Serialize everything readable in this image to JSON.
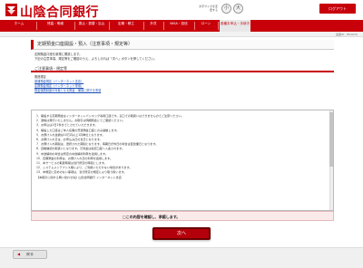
{
  "header": {
    "bank_name": "山陰合同銀行",
    "fontsize_label": "文字サイズを変更する",
    "fontsize_small": "小",
    "fontsize_large": "大",
    "logout": "ログアウト"
  },
  "nav": {
    "items": [
      {
        "label": "ホーム"
      },
      {
        "label": "残高・明細"
      },
      {
        "label": "振込・振替・払込"
      },
      {
        "label": "定期・積立"
      },
      {
        "label": "外貨"
      },
      {
        "label": "NISA・投信"
      },
      {
        "label": "ローン"
      },
      {
        "label": "各種お申込・手続き"
      }
    ]
  },
  "screen_id": "画面ID：BSA010",
  "page": {
    "title": "定期預金口座開設・預入（注意事項・規定等）",
    "intro": [
      "定期預金口座を新規に開設します。",
      "下記の注意事項、規定等をご確認のうえ、よろしければ「次へ」ボタンを押してください。"
    ],
    "section_title": "ご注意事項・規定等",
    "links_head": "関連規定",
    "links": [
      "普通預金規定（インターネット支店）",
      "定期預金規定（インターネット専用）",
      "預金保険制度の対象となる預金・補償に関する事項"
    ]
  },
  "terms": [
    "1．開設する定期預金はインターネットバンキング専用口座です。窓口での取扱いはできませんのでご注意ください。",
    "2．通帳は発行いたしません。お取引は明細照会にてご確認ください。",
    "3．お申込は1日1件までとさせていただきます。",
    "4．開設した口座はご本人名義の普通預金口座とのみ連動します。",
    "5．お預け入れ金額は10万円以上1円単位となります。",
    "6．お預け入れ日は、お申込み日の当日となります。",
    "7．お預け入れ期間は、選択された期間となります。満期日が休日の場合は翌営業日となります。",
    "8．自動継続の取扱いとなります。元利金は指定口座へ入金されます。",
    "9．中途解約の場合は所定の中途解約利率を適用します。",
    "10．定期預金の利率は、お預け入れ日の利率を適用します。",
    "11．本サービスの取扱時間は当行所定の時間とします。",
    "12．システムメンテナンス等により、ご利用いただけない場合があります。",
    "13．本規定に定めのない事項は、当行所定の規定により取り扱います。",
    "【本取引に関する問い合わせ先】山陰合同銀行 インターネット支店"
  ],
  "confirm_label": "□この内容を確認し、承諾します。",
  "next_button": "次へ",
  "back_button": "戻る",
  "colors": {
    "brand": "#c8000a",
    "link": "#1a4fb5"
  }
}
